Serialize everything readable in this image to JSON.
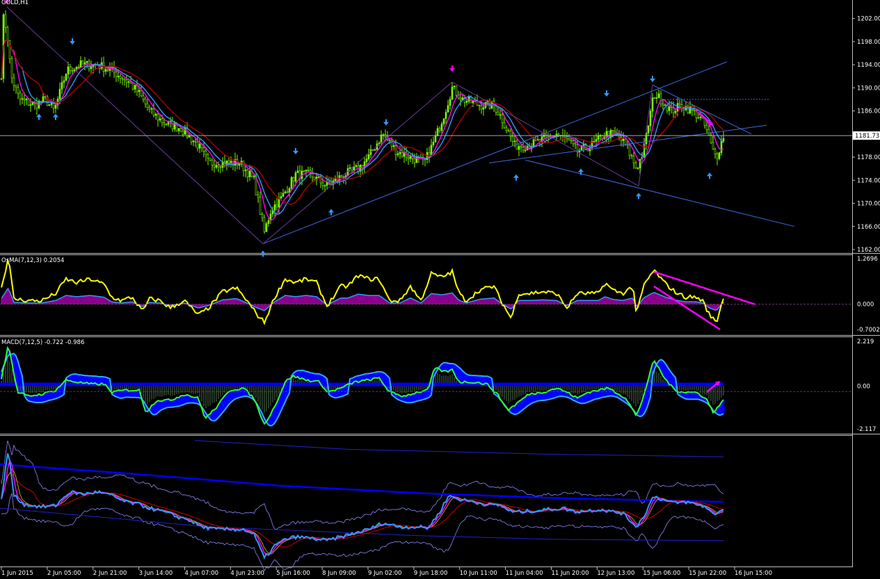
{
  "chart_data": [
    {
      "type": "candlestick",
      "panel": "main",
      "title": "GOLD,H1",
      "ylim": [
        1162.0,
        1204.0
      ],
      "yticks": [
        "1202.00",
        "1198.00",
        "1194.00",
        "1190.00",
        "1186.00",
        "1182.00",
        "1178.00",
        "1174.00",
        "1170.00",
        "1166.00",
        "1162.00"
      ],
      "current_price": "1181.73",
      "moving_averages": [
        "fast (magenta)",
        "medium (blue)",
        "slow (dark red)"
      ],
      "fractal_arrows": "up arrows at lows, down arrows at highs",
      "price_path": [
        [
          0,
          1186
        ],
        [
          5,
          1202
        ],
        [
          10,
          1200
        ],
        [
          16,
          1192
        ],
        [
          28,
          1188
        ],
        [
          50,
          1187
        ],
        [
          65,
          1188
        ],
        [
          78,
          1186
        ],
        [
          96,
          1193
        ],
        [
          115,
          1194
        ],
        [
          140,
          1194
        ],
        [
          160,
          1193
        ],
        [
          185,
          1191
        ],
        [
          200,
          1189
        ],
        [
          215,
          1186
        ],
        [
          235,
          1184
        ],
        [
          260,
          1183
        ],
        [
          285,
          1180
        ],
        [
          300,
          1177
        ],
        [
          320,
          1177
        ],
        [
          345,
          1177
        ],
        [
          365,
          1174
        ],
        [
          380,
          1165
        ],
        [
          390,
          1169
        ],
        [
          405,
          1171
        ],
        [
          425,
          1175
        ],
        [
          445,
          1175
        ],
        [
          470,
          1173
        ],
        [
          495,
          1175
        ],
        [
          515,
          1176
        ],
        [
          530,
          1178
        ],
        [
          550,
          1182
        ],
        [
          570,
          1179
        ],
        [
          590,
          1178
        ],
        [
          610,
          1177
        ],
        [
          625,
          1181
        ],
        [
          640,
          1186
        ],
        [
          650,
          1190
        ],
        [
          665,
          1188
        ],
        [
          690,
          1187
        ],
        [
          710,
          1187
        ],
        [
          720,
          1185
        ],
        [
          740,
          1180
        ],
        [
          760,
          1180
        ],
        [
          780,
          1181
        ],
        [
          800,
          1182
        ],
        [
          815,
          1181
        ],
        [
          830,
          1179
        ],
        [
          850,
          1180
        ],
        [
          870,
          1182
        ],
        [
          885,
          1182
        ],
        [
          900,
          1180
        ],
        [
          915,
          1176
        ],
        [
          925,
          1179
        ],
        [
          940,
          1189
        ],
        [
          950,
          1188
        ],
        [
          965,
          1186
        ],
        [
          980,
          1187
        ],
        [
          995,
          1186
        ],
        [
          1005,
          1185
        ],
        [
          1015,
          1183
        ],
        [
          1025,
          1179
        ],
        [
          1030,
          1178
        ],
        [
          1040,
          1181.7
        ]
      ]
    },
    {
      "type": "histogram",
      "panel": "osma",
      "title": "OsMA(7,12,3) 0.2054",
      "ylim": [
        -0.7002,
        1.2696
      ],
      "yticks": [
        "1.2696",
        "0.000",
        "-0.7002"
      ],
      "signal_path": [
        [
          0,
          0.3
        ],
        [
          12,
          1.3
        ],
        [
          20,
          0.15
        ],
        [
          40,
          0.1
        ],
        [
          60,
          0.1
        ],
        [
          80,
          0.3
        ],
        [
          95,
          0.7
        ],
        [
          110,
          0.6
        ],
        [
          130,
          0.7
        ],
        [
          150,
          0.55
        ],
        [
          160,
          0.2
        ],
        [
          175,
          0.1
        ],
        [
          190,
          0.2
        ],
        [
          205,
          -0.2
        ],
        [
          215,
          0.15
        ],
        [
          230,
          0.1
        ],
        [
          245,
          -0.1
        ],
        [
          265,
          0.1
        ],
        [
          285,
          -0.3
        ],
        [
          300,
          -0.1
        ],
        [
          320,
          0.35
        ],
        [
          340,
          0.45
        ],
        [
          355,
          0.1
        ],
        [
          370,
          -0.3
        ],
        [
          380,
          -0.5
        ],
        [
          395,
          0.2
        ],
        [
          410,
          0.7
        ],
        [
          425,
          0.6
        ],
        [
          440,
          0.7
        ],
        [
          455,
          0.6
        ],
        [
          470,
          -0.05
        ],
        [
          490,
          0.5
        ],
        [
          500,
          0.5
        ],
        [
          515,
          0.8
        ],
        [
          530,
          0.7
        ],
        [
          545,
          0.7
        ],
        [
          560,
          0.1
        ],
        [
          575,
          0.1
        ],
        [
          590,
          0.5
        ],
        [
          605,
          0.1
        ],
        [
          620,
          0.85
        ],
        [
          635,
          0.75
        ],
        [
          650,
          0.9
        ],
        [
          660,
          0.3
        ],
        [
          670,
          0.1
        ],
        [
          690,
          0.4
        ],
        [
          710,
          0.5
        ],
        [
          720,
          0.1
        ],
        [
          735,
          -0.4
        ],
        [
          745,
          0.3
        ],
        [
          760,
          0.3
        ],
        [
          780,
          0.35
        ],
        [
          800,
          0.3
        ],
        [
          815,
          -0.1
        ],
        [
          830,
          0.3
        ],
        [
          845,
          0.3
        ],
        [
          860,
          0.3
        ],
        [
          870,
          0.6
        ],
        [
          880,
          0.4
        ],
        [
          895,
          0.3
        ],
        [
          910,
          0.5
        ],
        [
          915,
          -0.3
        ],
        [
          925,
          0.5
        ],
        [
          940,
          0.95
        ],
        [
          955,
          0.6
        ],
        [
          970,
          0.35
        ],
        [
          985,
          0.2
        ],
        [
          1000,
          0.2
        ],
        [
          1010,
          0.1
        ],
        [
          1020,
          -0.3
        ],
        [
          1030,
          -0.5
        ],
        [
          1040,
          0.2
        ]
      ]
    },
    {
      "type": "histogram",
      "panel": "macd",
      "title": "MACD(7,12,5) -0.722 -0.986",
      "ylim": [
        -2.117,
        2.219
      ],
      "yticks": [
        "2.219",
        "0.00",
        "-2.117"
      ],
      "main_path": [
        [
          0,
          0
        ],
        [
          12,
          2.1
        ],
        [
          25,
          -0.3
        ],
        [
          40,
          -0.5
        ],
        [
          60,
          -0.4
        ],
        [
          80,
          -0.2
        ],
        [
          95,
          0.3
        ],
        [
          110,
          0.2
        ],
        [
          130,
          0.1
        ],
        [
          150,
          0.1
        ],
        [
          160,
          -0.3
        ],
        [
          180,
          -0.2
        ],
        [
          200,
          -0.2
        ],
        [
          210,
          -1.3
        ],
        [
          225,
          -0.7
        ],
        [
          245,
          -0.7
        ],
        [
          265,
          -0.4
        ],
        [
          285,
          -0.6
        ],
        [
          295,
          -1.6
        ],
        [
          310,
          -1.1
        ],
        [
          330,
          -0.2
        ],
        [
          350,
          -0.1
        ],
        [
          365,
          -0.6
        ],
        [
          380,
          -1.9
        ],
        [
          395,
          -1.0
        ],
        [
          410,
          0.2
        ],
        [
          420,
          0.5
        ],
        [
          440,
          0.3
        ],
        [
          460,
          0.2
        ],
        [
          470,
          -0.3
        ],
        [
          490,
          -0.1
        ],
        [
          510,
          0.2
        ],
        [
          530,
          0.3
        ],
        [
          545,
          0.4
        ],
        [
          560,
          -0.3
        ],
        [
          580,
          -0.5
        ],
        [
          600,
          -0.3
        ],
        [
          615,
          -0.2
        ],
        [
          625,
          0.9
        ],
        [
          640,
          0.7
        ],
        [
          650,
          0.8
        ],
        [
          660,
          0.2
        ],
        [
          680,
          0.2
        ],
        [
          700,
          0.1
        ],
        [
          715,
          -0.4
        ],
        [
          730,
          -1.2
        ],
        [
          745,
          -0.8
        ],
        [
          760,
          -0.4
        ],
        [
          780,
          -0.3
        ],
        [
          800,
          -0.1
        ],
        [
          815,
          -0.3
        ],
        [
          830,
          -0.6
        ],
        [
          845,
          -0.3
        ],
        [
          860,
          -0.2
        ],
        [
          875,
          -0.1
        ],
        [
          885,
          -0.3
        ],
        [
          900,
          -0.6
        ],
        [
          915,
          -1.5
        ],
        [
          925,
          -0.5
        ],
        [
          940,
          1.3
        ],
        [
          955,
          0.4
        ],
        [
          970,
          -0.2
        ],
        [
          985,
          -0.3
        ],
        [
          1000,
          -0.3
        ],
        [
          1015,
          -0.6
        ],
        [
          1025,
          -1.3
        ],
        [
          1040,
          -0.72
        ]
      ]
    },
    {
      "type": "line",
      "panel": "bands",
      "title": "",
      "ylim": [
        0,
        1
      ],
      "price_path": [
        [
          0,
          0.45
        ],
        [
          12,
          0.92
        ],
        [
          20,
          0.55
        ],
        [
          35,
          0.48
        ],
        [
          60,
          0.46
        ],
        [
          80,
          0.47
        ],
        [
          100,
          0.58
        ],
        [
          120,
          0.56
        ],
        [
          140,
          0.58
        ],
        [
          160,
          0.55
        ],
        [
          180,
          0.5
        ],
        [
          200,
          0.48
        ],
        [
          215,
          0.45
        ],
        [
          235,
          0.42
        ],
        [
          255,
          0.38
        ],
        [
          270,
          0.36
        ],
        [
          290,
          0.3
        ],
        [
          310,
          0.28
        ],
        [
          330,
          0.28
        ],
        [
          350,
          0.28
        ],
        [
          365,
          0.24
        ],
        [
          380,
          0.05
        ],
        [
          395,
          0.15
        ],
        [
          410,
          0.2
        ],
        [
          425,
          0.22
        ],
        [
          445,
          0.21
        ],
        [
          470,
          0.19
        ],
        [
          490,
          0.22
        ],
        [
          510,
          0.25
        ],
        [
          530,
          0.28
        ],
        [
          550,
          0.33
        ],
        [
          575,
          0.3
        ],
        [
          600,
          0.3
        ],
        [
          615,
          0.29
        ],
        [
          630,
          0.4
        ],
        [
          645,
          0.55
        ],
        [
          660,
          0.52
        ],
        [
          680,
          0.5
        ],
        [
          700,
          0.48
        ],
        [
          720,
          0.47
        ],
        [
          735,
          0.42
        ],
        [
          750,
          0.42
        ],
        [
          770,
          0.43
        ],
        [
          790,
          0.44
        ],
        [
          810,
          0.45
        ],
        [
          825,
          0.42
        ],
        [
          845,
          0.43
        ],
        [
          865,
          0.44
        ],
        [
          880,
          0.42
        ],
        [
          895,
          0.41
        ],
        [
          915,
          0.3
        ],
        [
          925,
          0.38
        ],
        [
          940,
          0.55
        ],
        [
          955,
          0.51
        ],
        [
          970,
          0.49
        ],
        [
          985,
          0.5
        ],
        [
          1000,
          0.48
        ],
        [
          1015,
          0.46
        ],
        [
          1025,
          0.4
        ],
        [
          1040,
          0.44
        ]
      ],
      "long_ma_path": [
        [
          0,
          0.8
        ],
        [
          200,
          0.72
        ],
        [
          400,
          0.63
        ],
        [
          600,
          0.57
        ],
        [
          800,
          0.53
        ],
        [
          1040,
          0.5
        ]
      ],
      "upper_env_path": [
        [
          280,
          0.99
        ],
        [
          500,
          0.92
        ],
        [
          800,
          0.88
        ],
        [
          1040,
          0.86
        ]
      ],
      "lower_env_path": [
        [
          0,
          0.45
        ],
        [
          300,
          0.3
        ],
        [
          600,
          0.23
        ],
        [
          800,
          0.2
        ],
        [
          1040,
          0.19
        ]
      ]
    }
  ],
  "time_axis": {
    "labels": [
      "1 Jun 2015",
      "2 Jun 05:00",
      "2 Jun 21:00",
      "3 Jun 14:00",
      "4 Jun 07:00",
      "4 Jun 23:00",
      "5 Jun 16:00",
      "8 Jun 09:00",
      "9 Jun 02:00",
      "9 Jun 18:00",
      "10 Jun 11:00",
      "11 Jun 04:00",
      "11 Jun 20:00",
      "12 Jun 13:00",
      "15 Jun 06:00",
      "15 Jun 22:00",
      "16 Jun 15:00"
    ]
  },
  "colors": {
    "background": "#000000",
    "grid": "#bfbfbf",
    "bull_candle": "#7cfc00",
    "ma_fast": "#ff00ff",
    "ma_medium": "#3399ff",
    "ma_slow": "#b00000",
    "trendline": "#4169e1",
    "osma_line": "#ffff00",
    "osma_hist": "#8b008b",
    "macd_hist": "#0000ff",
    "macd_main": "#33ff33",
    "macd_signal": "#33aaff",
    "annotation": "#ff00ff"
  }
}
